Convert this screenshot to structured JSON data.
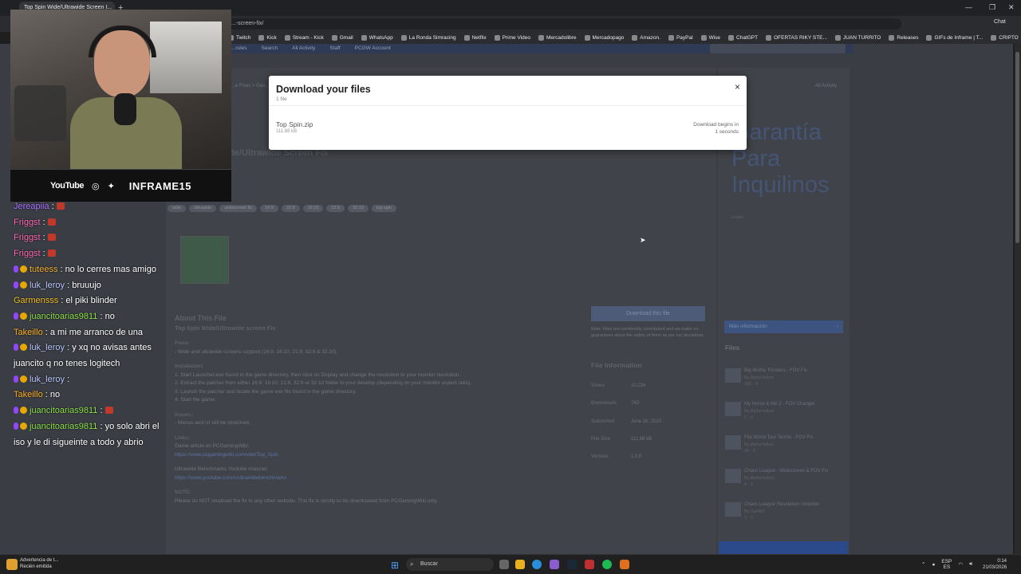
{
  "browser": {
    "tab_title": "Top Spin Wide/Ultrawide Screen I...",
    "new_tab": "+",
    "url": "...-screen-fix/",
    "bookmarks": [
      "Twitch",
      "Kick",
      "Stream - Kick",
      "Gmail",
      "WhatsApp",
      "La Ronda Simracing",
      "Netflix",
      "Prime Video",
      "Mercadolibre",
      "Mercadopago",
      "Amazon.",
      "PayPal",
      "Wise",
      "ChatGPT",
      "OFERTAS RIKY STE...",
      "JUAN TURRITO",
      "Releases",
      "GIFs de Inframe | T...",
      "CRIPTO"
    ],
    "chat_label": "Chat"
  },
  "site": {
    "nav": [
      "...rules",
      "Search",
      "All Activity",
      "Staff",
      "PCGW Account"
    ],
    "search_placeholder": "Search...",
    "breadcrumb": "...e Fixes > Gen...",
    "all_activity": "All Activity",
    "file_title": "...de/Ultrawide Screen Fix",
    "tags": [
      "wide",
      "ultrawide",
      "widescreen fix",
      "16:9",
      "21:9",
      "16:10",
      "32:9",
      "32:10",
      "top spin"
    ],
    "about": {
      "heading": "About This File",
      "subtitle": "Top Spin Wide/Ultrawide screen Fix",
      "fixes_label": "Fixes:",
      "fixes_text": "- Wide and ultrawide screens support (16:9, 16:10, 21:9, 32:9 & 32:10).",
      "install_label": "Installation:",
      "install_steps": [
        "1. Start Launcher.exe found in the game directory, then click on Display and change the resolution to your monitor resolution.",
        "2. Extract the patcher from either 16:9, 16:10, 21:9, 32:9 or 32:10 folder to your desktop (depending on your monitor aspect ratio).",
        "3. Launch the patcher and locate the game exe file found in the game directory.",
        "4. Start the game."
      ],
      "issues_label": "Issues:",
      "issues_text": "- Menus and UI will be stretched.",
      "links_label": "Links:",
      "link1_text": "Game article on PCGamingWiki:",
      "link1_url": "https://www.pcgamingwiki.com/wiki/Top_Spin",
      "link2_text": "Ultrawide Benchmarks Youtube channel:",
      "link2_url": "https://www.youtube.com/c/ultrawidebenchmarks",
      "note_label": "NOTE:",
      "note_text": "Please do NOT reupload the fix to any other website. This fix is strictly to be downloaded from PCGamingWiki only."
    },
    "download_button": "Download this file",
    "download_note": "Note: Files are community contributed and we make no guarantees about the safety of them as per our disclaimer.",
    "file_info_title": "File Information",
    "file_info": [
      {
        "k": "Views",
        "v": "10,234"
      },
      {
        "k": "Downloads",
        "v": "743"
      },
      {
        "k": "Submitted",
        "v": "June 26, 2020"
      },
      {
        "k": "File Size",
        "v": "111.88 kB"
      },
      {
        "k": "Version",
        "v": "1.0.0"
      }
    ],
    "ad_text": "Garantía Para Inquilinos",
    "ad_small": "Finaer",
    "more_info": "Más información",
    "files_heading": "Files",
    "related_files": [
      {
        "title": "Big Mutha Truckers - FOV Fix",
        "by": "By AlphaYellow",
        "meta": "256 · 8"
      },
      {
        "title": "My Horse & Me 2 - FOV Changer",
        "by": "By AlphaYellow",
        "meta": "2 · 0"
      },
      {
        "title": "Fila World Tour Tennis - FOV Fix",
        "by": "By AlphaYellow",
        "meta": "44 · 0"
      },
      {
        "title": "Chaos League - Widescreen & FOV Fix",
        "by": "By AlphaYellow",
        "meta": "4 · 0"
      },
      {
        "title": "Chaos League Resolution Unlocker",
        "by": "By 2a4456",
        "meta": "7 · 0"
      }
    ]
  },
  "modal": {
    "title": "Download your files",
    "count": "1 file",
    "filename": "Top Spin.zip",
    "filesize": "111.88 kB",
    "begin_line1": "Download begins in",
    "begin_line2": "1 seconds",
    "close": "×"
  },
  "stream": {
    "youtube": "YouTube",
    "channel": "INFRAME15"
  },
  "chat": [
    {
      "user": "Jereapiia",
      "msg": "",
      "color": "#a970ff",
      "badge": false,
      "emote": true
    },
    {
      "user": "Friggst",
      "msg": "",
      "color": "#ff69b4",
      "badge": false,
      "emote": true
    },
    {
      "user": "Friggst",
      "msg": "",
      "color": "#ff69b4",
      "badge": false,
      "emote": true
    },
    {
      "user": "Friggst",
      "msg": "",
      "color": "#ff69b4",
      "badge": false,
      "emote": true
    },
    {
      "user": "tuteess",
      "msg": "no lo cerres mas amigo",
      "color": "#f0b030",
      "badge": true,
      "emote": false
    },
    {
      "user": "luk_leroy",
      "msg": "bruuujo",
      "color": "#b8c8ff",
      "badge": true,
      "emote": false
    },
    {
      "user": "Garmensss",
      "msg": "el piki blinder",
      "color": "#f0c020",
      "badge": false,
      "emote": false
    },
    {
      "user": "juancitoarias9811",
      "msg": "no",
      "color": "#8be04a",
      "badge": true,
      "emote": false
    },
    {
      "user": "Takeillo",
      "msg": "a mi me arranco de una",
      "color": "#ffb020",
      "badge": false,
      "emote": false
    },
    {
      "user": "luk_leroy",
      "msg": "y xq no avisas antes",
      "color": "#b8c8ff",
      "badge": true,
      "emote": false
    },
    {
      "user": "",
      "msg": "juancito q no tenes logitech",
      "color": "#fff",
      "badge": false,
      "emote": false
    },
    {
      "user": "luk_leroy",
      "msg": "",
      "color": "#b8c8ff",
      "badge": true,
      "emote": false
    },
    {
      "user": "Takeillo",
      "msg": "no",
      "color": "#ffb020",
      "badge": false,
      "emote": false
    },
    {
      "user": "juancitoarias9811",
      "msg": "",
      "color": "#8be04a",
      "badge": true,
      "emote": true
    },
    {
      "user": "juancitoarias9811",
      "msg": "yo solo abri el",
      "color": "#8be04a",
      "badge": true,
      "emote": false
    },
    {
      "user": "",
      "msg": "iso y le di sigueinte a todo y abrio",
      "color": "#fff",
      "badge": false,
      "emote": false
    }
  ],
  "taskbar": {
    "notif_title": "Advertencia de t...",
    "notif_sub": "Recién emitida",
    "search": "Buscar",
    "lang": "ESP",
    "region": "ES",
    "time": "0:14",
    "date": "21/03/2026"
  }
}
